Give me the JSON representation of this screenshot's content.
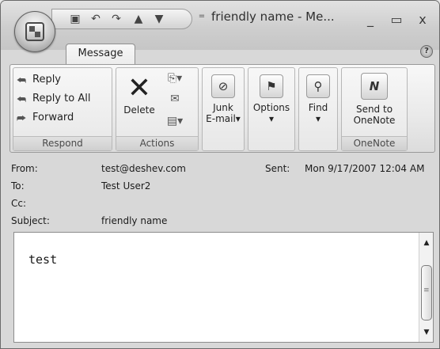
{
  "window": {
    "title": "friendly name - Me...",
    "controls": {
      "minimize": "_",
      "maximize": "▭",
      "close": "x"
    }
  },
  "quick_access": {
    "icons": [
      "save-icon",
      "undo-icon",
      "redo-icon",
      "previous-item-icon",
      "next-item-icon"
    ],
    "customize_glyph": "="
  },
  "tabs": [
    {
      "label": "Message",
      "active": true
    }
  ],
  "help_glyph": "?",
  "ribbon": {
    "respond": {
      "label": "Respond",
      "reply": "Reply",
      "reply_all": "Reply to All",
      "forward": "Forward"
    },
    "actions": {
      "label": "Actions",
      "delete": "Delete"
    },
    "junk": {
      "line1": "Junk",
      "line2": "E-mail"
    },
    "options": {
      "label": "Options"
    },
    "find": {
      "label": "Find"
    },
    "onenote": {
      "label": "OneNote",
      "send_line1": "Send to",
      "send_line2": "OneNote"
    },
    "dropdown_glyph": "▾"
  },
  "header": {
    "from_label": "From:",
    "from_value": "test@deshev.com",
    "sent_label": "Sent:",
    "sent_value": "Mon 9/17/2007 12:04 AM",
    "to_label": "To:",
    "to_value": "Test User2",
    "cc_label": "Cc:",
    "cc_value": "",
    "subject_label": "Subject:",
    "subject_value": "friendly name"
  },
  "message": {
    "body": "test"
  },
  "scrollbar": {
    "up_glyph": "▲",
    "down_glyph": "▼"
  }
}
